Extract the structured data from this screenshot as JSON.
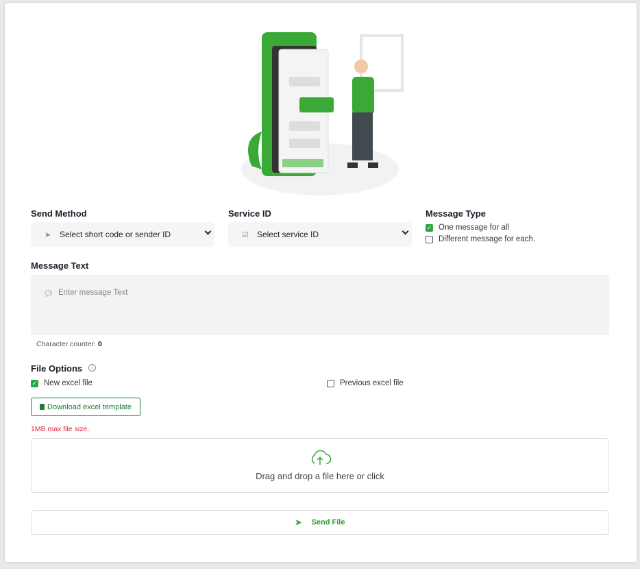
{
  "send_method": {
    "label": "Send Method",
    "placeholder": "Select short code or sender ID"
  },
  "service_id": {
    "label": "Service ID",
    "placeholder": "Select service ID"
  },
  "message_type": {
    "label": "Message Type",
    "options": [
      {
        "label": "One message for all",
        "checked": true
      },
      {
        "label": "Different message for each.",
        "checked": false
      }
    ]
  },
  "message_text": {
    "label": "Message Text",
    "placeholder": "Enter message Text",
    "counter_label": "Character counter:",
    "counter_value": "0"
  },
  "file_options": {
    "label": "File Options",
    "options": [
      {
        "label": "New excel file",
        "checked": true
      },
      {
        "label": "Previous excel file",
        "checked": false
      }
    ],
    "download_label": "Download excel template",
    "max_size": "1MB max file size."
  },
  "dropzone": {
    "text": "Drag and drop a file here or click"
  },
  "send": {
    "label": "Send File"
  },
  "colors": {
    "accent": "#3aa935",
    "error": "#d9263f"
  }
}
